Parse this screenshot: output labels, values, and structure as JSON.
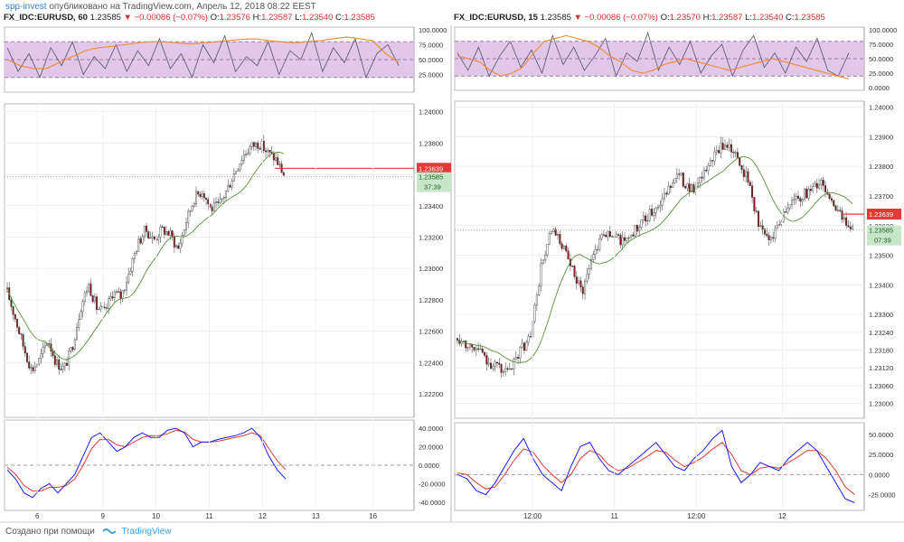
{
  "header": {
    "author": "spp-invest",
    "published": "опубликовано на TradingView.com, Апрель 12, 2018 08:22 EEST"
  },
  "footer": {
    "created_with": "Создано при помощи",
    "brand": "TradingView"
  },
  "colors": {
    "up": "#ffffff",
    "down": "#8b1a1a",
    "ma": "#5a8f3c",
    "osc_fast": "#1a1aff",
    "osc_slow": "#e53935",
    "rsi_fast": "#555566",
    "rsi_slow": "#f08a2a",
    "band": "#d9b9e3",
    "price_line": "#e53935",
    "tag_last": "#e53935",
    "tag_close": "#c8e6c9"
  },
  "left": {
    "symbol": "FX_IDC:EURUSD, 60",
    "last": "1.23585",
    "change": "−0.00086 (−0.07%)",
    "o_label": "O:",
    "o": "1.23576",
    "h_label": "H:",
    "h": "1.23587",
    "l_label": "L:",
    "l": "1.23540",
    "c_label": "C:",
    "c": "1.23585",
    "price_tag": "1.23639",
    "close_tag": "1.23585",
    "countdown": "37:39",
    "x_ticks": [
      "6",
      "9",
      "10",
      "11",
      "12",
      "13",
      "16"
    ],
    "rsi_ticks": [
      "100.0000",
      "75.0000",
      "50.0000",
      "25.0000"
    ],
    "osc_ticks": [
      "40.0000",
      "20.0000",
      "0.0000",
      "-20.0000",
      "-40.0000"
    ]
  },
  "right": {
    "symbol": "FX_IDC:EURUSD, 15",
    "last": "1.23585",
    "change": "−0.00086 (−0.07%)",
    "o_label": "O:",
    "o": "1.23570",
    "h_label": "H:",
    "h": "1.23587",
    "l_label": "L:",
    "l": "1.23540",
    "c_label": "C:",
    "c": "1.23585",
    "price_tag": "1.23639",
    "close_tag": "1.23585",
    "countdown": "07:39",
    "x_ticks": [
      "12:00",
      "11",
      "12:00",
      "12"
    ],
    "rsi_ticks": [
      "100.0000",
      "75.0000",
      "50.0000",
      "25.0000",
      "0.0000"
    ],
    "osc_ticks": [
      "50.0000",
      "25.0000",
      "0.0000",
      "-25.0000"
    ]
  },
  "chart_data": [
    {
      "type": "candlestick",
      "title": "FX_IDC:EURUSD, 60",
      "ylim": [
        1.2205,
        1.2405
      ],
      "y_ticks": [
        1.24,
        1.238,
        1.236,
        1.234,
        1.232,
        1.23,
        1.228,
        1.226,
        1.224,
        1.222
      ],
      "y_tick_labels": [
        "1.24000",
        "1.23800",
        "1.23600",
        "1.23400",
        "1.23200",
        "1.23000",
        "1.22800",
        "1.22600",
        "1.22400",
        "1.22200"
      ],
      "x_tick_labels": [
        "6",
        "9",
        "10",
        "11",
        "12",
        "13",
        "16"
      ],
      "close_path": [
        1.2285,
        1.2268,
        1.225,
        1.2235,
        1.2242,
        1.2255,
        1.224,
        1.2236,
        1.225,
        1.2275,
        1.229,
        1.2275,
        1.2272,
        1.2285,
        1.2282,
        1.2298,
        1.2315,
        1.2325,
        1.2318,
        1.2325,
        1.2322,
        1.2312,
        1.233,
        1.2345,
        1.235,
        1.2338,
        1.234,
        1.235,
        1.2362,
        1.2372,
        1.2378,
        1.238,
        1.2374,
        1.237,
        1.236
      ],
      "last_price": 1.23639,
      "close_price": 1.23585,
      "oscillator": {
        "type": "line",
        "ylim": [
          -45,
          45
        ],
        "y_ticks": [
          40,
          20,
          0,
          -20,
          -40
        ],
        "fast": [
          -5,
          -15,
          -30,
          -35,
          -25,
          -20,
          -30,
          -20,
          -10,
          10,
          30,
          35,
          25,
          15,
          20,
          30,
          35,
          30,
          30,
          38,
          40,
          35,
          20,
          25,
          25,
          28,
          30,
          32,
          35,
          40,
          30,
          10,
          -5,
          -15
        ],
        "slow": [
          -2,
          -10,
          -22,
          -28,
          -28,
          -24,
          -24,
          -22,
          -15,
          0,
          18,
          28,
          28,
          22,
          20,
          25,
          30,
          32,
          32,
          34,
          38,
          36,
          28,
          25,
          25,
          26,
          28,
          30,
          32,
          35,
          32,
          18,
          5,
          -5
        ]
      },
      "rsi": {
        "type": "line",
        "ylim": [
          0,
          100
        ],
        "y_ticks": [
          100,
          75,
          50,
          25
        ],
        "fast": [
          70,
          30,
          60,
          20,
          70,
          40,
          80,
          25,
          55,
          35,
          75,
          30,
          65,
          40,
          85,
          35,
          60,
          20,
          75,
          45,
          90,
          30,
          55,
          40,
          80,
          25,
          65,
          50,
          95,
          30,
          70,
          45,
          85,
          20,
          60,
          75,
          40
        ],
        "slow": [
          50,
          40,
          35,
          35,
          45,
          55,
          65,
          70,
          72,
          75,
          78,
          80,
          80,
          78,
          76,
          78,
          80,
          82,
          84,
          85,
          82,
          80,
          78,
          80,
          82,
          85,
          88,
          85,
          82,
          60,
          45
        ]
      }
    },
    {
      "type": "candlestick",
      "title": "FX_IDC:EURUSD, 15",
      "ylim": [
        1.2295,
        1.2402
      ],
      "y_ticks": [
        1.24,
        1.239,
        1.238,
        1.237,
        1.236,
        1.235,
        1.234,
        1.233,
        1.2324,
        1.2318,
        1.2312,
        1.2306,
        1.23
      ],
      "y_tick_labels": [
        "1.24000",
        "1.23900",
        "1.23800",
        "1.23700",
        "1.23600",
        "1.23500",
        "1.23400",
        "1.23300",
        "1.23240",
        "1.23180",
        "1.23120",
        "1.23060",
        "1.23000"
      ],
      "x_tick_labels": [
        "12:00",
        "11",
        "12:00",
        "12"
      ],
      "close_path": [
        1.2322,
        1.232,
        1.2318,
        1.2314,
        1.2312,
        1.231,
        1.2318,
        1.2322,
        1.2345,
        1.2358,
        1.2354,
        1.2345,
        1.2338,
        1.235,
        1.2358,
        1.2356,
        1.2355,
        1.2358,
        1.2362,
        1.2366,
        1.237,
        1.2378,
        1.2374,
        1.2372,
        1.238,
        1.2385,
        1.2388,
        1.2382,
        1.2375,
        1.236,
        1.2355,
        1.2362,
        1.2368,
        1.237,
        1.2372,
        1.2375,
        1.2368,
        1.2362,
        1.236
      ],
      "last_price": 1.23639,
      "close_price": 1.23585,
      "oscillator": {
        "type": "line",
        "ylim": [
          -40,
          60
        ],
        "y_ticks": [
          50,
          25,
          0,
          -25
        ],
        "fast": [
          0,
          -5,
          -20,
          -25,
          -10,
          10,
          30,
          45,
          20,
          0,
          -10,
          -20,
          10,
          35,
          40,
          20,
          5,
          0,
          10,
          20,
          30,
          40,
          25,
          10,
          5,
          20,
          30,
          45,
          55,
          10,
          -10,
          0,
          15,
          10,
          5,
          20,
          30,
          40,
          30,
          10,
          -10,
          -30,
          -35
        ],
        "slow": [
          2,
          0,
          -10,
          -18,
          -15,
          0,
          18,
          32,
          28,
          12,
          0,
          -10,
          0,
          20,
          30,
          25,
          12,
          5,
          8,
          15,
          22,
          30,
          28,
          18,
          10,
          15,
          22,
          32,
          40,
          25,
          5,
          0,
          8,
          10,
          8,
          15,
          22,
          30,
          30,
          20,
          5,
          -15,
          -25
        ]
      },
      "rsi": {
        "type": "line",
        "ylim": [
          0,
          100
        ],
        "y_ticks": [
          100,
          75,
          50,
          25,
          0
        ],
        "fast": [
          60,
          30,
          70,
          20,
          55,
          80,
          35,
          65,
          25,
          90,
          40,
          70,
          30,
          55,
          85,
          20,
          60,
          45,
          95,
          30,
          70,
          40,
          80,
          25,
          55,
          75,
          20,
          65,
          90,
          35,
          60,
          25,
          70,
          45,
          85,
          30,
          20,
          60
        ],
        "slow": [
          55,
          50,
          45,
          30,
          20,
          25,
          35,
          60,
          80,
          85,
          90,
          85,
          80,
          70,
          55,
          45,
          30,
          25,
          30,
          40,
          45,
          50,
          45,
          40,
          35,
          30,
          35,
          40,
          45,
          50,
          45,
          40,
          35,
          30,
          25,
          20,
          15
        ]
      }
    }
  ]
}
